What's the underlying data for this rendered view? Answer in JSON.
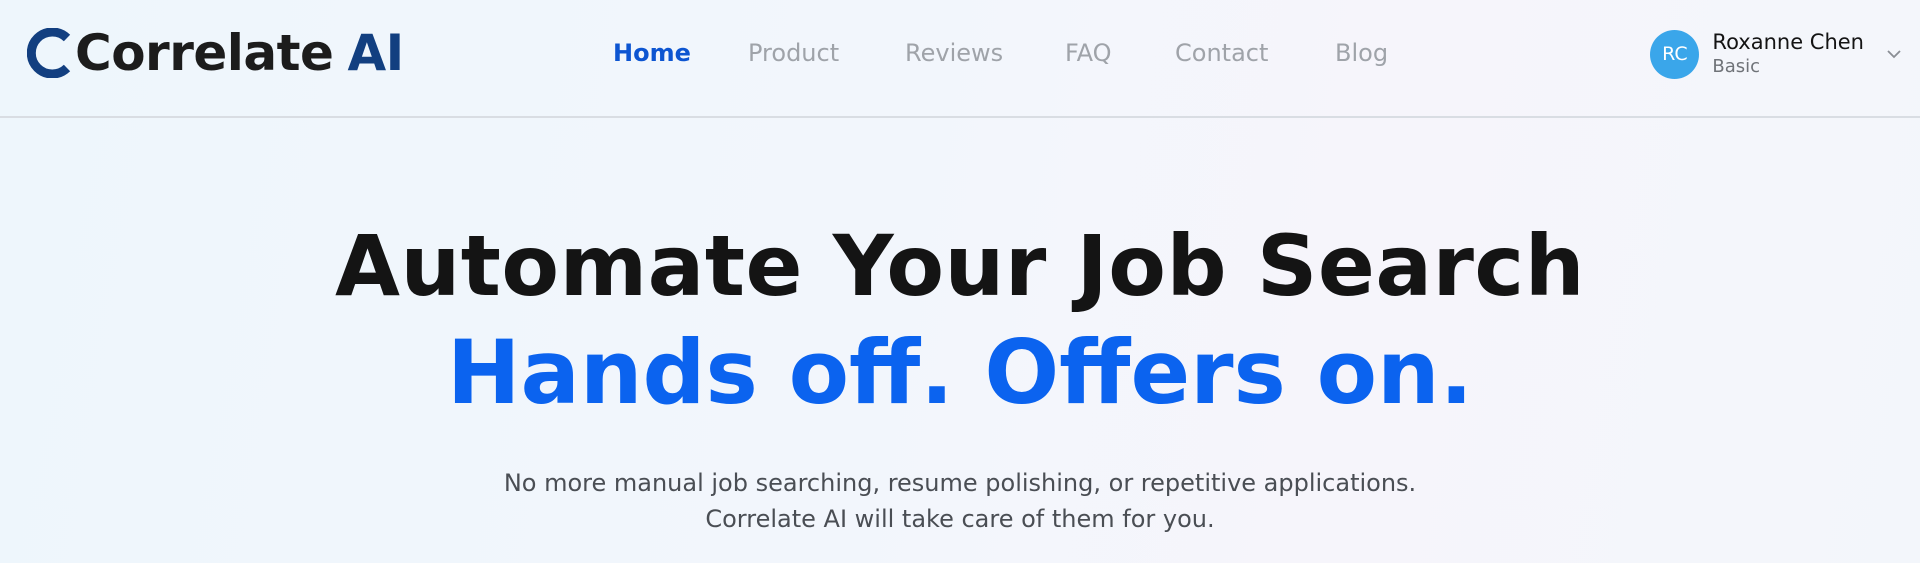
{
  "brand": {
    "name": "Correlate",
    "suffix": "AI",
    "colors": {
      "primary": "#123f80",
      "accent": "#0b63ef"
    }
  },
  "nav": {
    "items": [
      {
        "label": "Home",
        "active": true
      },
      {
        "label": "Product",
        "active": false
      },
      {
        "label": "Reviews",
        "active": false
      },
      {
        "label": "FAQ",
        "active": false
      },
      {
        "label": "Contact",
        "active": false
      },
      {
        "label": "Blog",
        "active": false
      }
    ],
    "active_color": "#0d55d1",
    "inactive_color": "#9fa3a9"
  },
  "user": {
    "initials": "RC",
    "name": "Roxanne Chen",
    "plan": "Basic",
    "avatar_color": "#3aa6ea",
    "menu_icon": "chevron-down-icon"
  },
  "hero": {
    "title": "Automate Your Job Search",
    "subtitle": "Hands off. Offers on.",
    "description_lines": [
      "No more manual job searching, resume polishing, or repetitive applications.",
      "Correlate AI will take care of them for you."
    ]
  }
}
